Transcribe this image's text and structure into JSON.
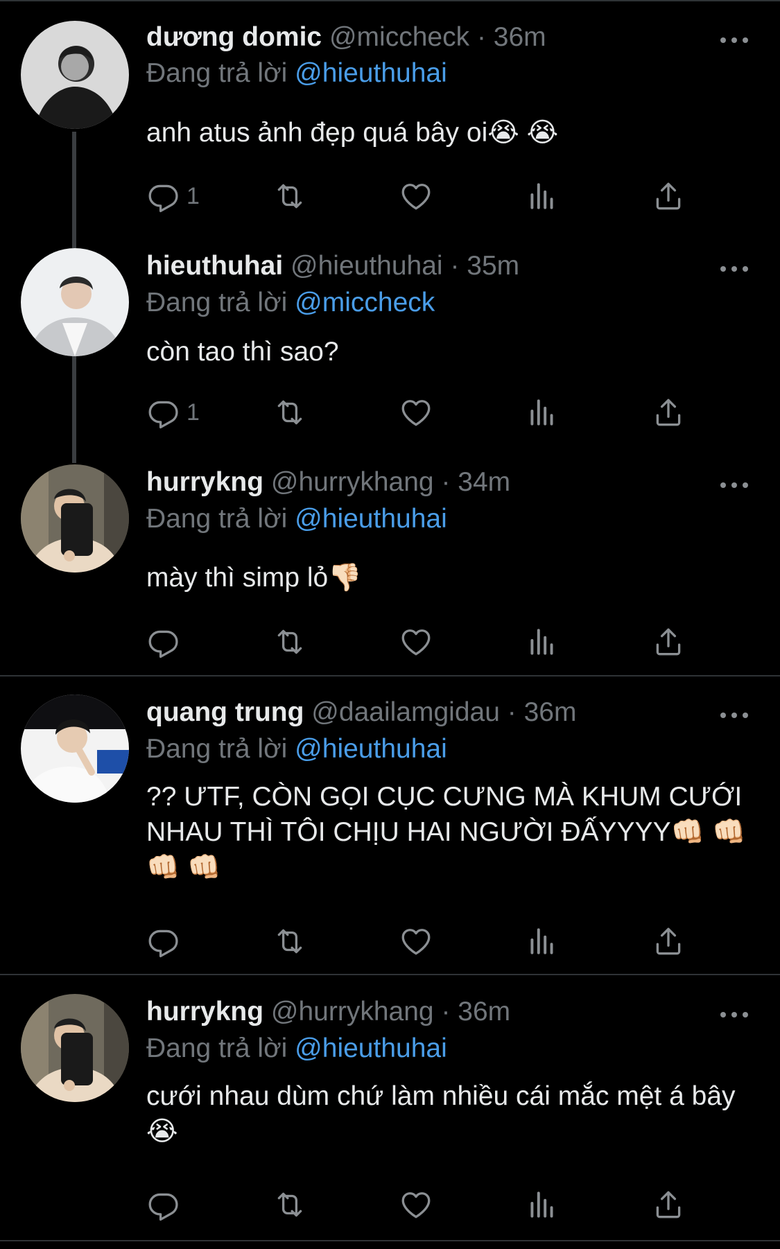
{
  "thread_label": "Đang trả lời",
  "tweets": [
    {
      "name": "dương domic",
      "handle": "@miccheck",
      "dot": "·",
      "time": "36m",
      "replying_to": "@hieuthuhai",
      "text": "anh atus ảnh đẹp quá bây oi😭 😭",
      "reply_count": "1",
      "avatar_colors": {
        "bg": "#d9d9d9",
        "fg": "#1a1a1a"
      }
    },
    {
      "name": "hieuthuhai",
      "handle": "@hieuthuhai",
      "dot": "·",
      "time": "35m",
      "replying_to": "@miccheck",
      "text": "còn tao thì sao?",
      "reply_count": "1",
      "avatar_colors": {
        "bg": "#eef0f2",
        "fg": "#b9bcc0"
      }
    },
    {
      "name": "hurrykng",
      "handle": "@hurrykhang",
      "dot": "·",
      "time": "34m",
      "replying_to": "@hieuthuhai",
      "text": "mày thì simp lỏ👎🏻",
      "reply_count": "",
      "avatar_colors": {
        "bg": "#6f6a5d",
        "fg": "#ead9c4"
      }
    },
    {
      "name": "quang trung",
      "handle": "@daailamgidau",
      "dot": "·",
      "time": "36m",
      "replying_to": "@hieuthuhai",
      "text": "?? ƯTF, CÒN GỌI CỤC CƯNG MÀ KHUM CƯỚI NHAU THÌ TÔI CHỊU HAI NGƯỜI ĐẤYYYY👊🏻 👊🏻 👊🏻 👊🏻",
      "reply_count": "",
      "avatar_colors": {
        "bg": "#f3f3f3",
        "fg": "#1e4fa8"
      }
    },
    {
      "name": "hurrykng",
      "handle": "@hurrykhang",
      "dot": "·",
      "time": "36m",
      "replying_to": "@hieuthuhai",
      "text": "cưới nhau dùm chứ làm nhiều cái mắc mệt á bây😭",
      "reply_count": "",
      "avatar_colors": {
        "bg": "#6f6a5d",
        "fg": "#ead9c4"
      }
    }
  ],
  "icons": [
    "reply-icon",
    "retweet-icon",
    "like-icon",
    "analytics-icon",
    "share-icon",
    "more-icon"
  ],
  "colors": {
    "background": "#000000",
    "text": "#e7e9ea",
    "secondary": "#71767b",
    "mention": "#4a9de8",
    "divider": "#2f3336"
  }
}
